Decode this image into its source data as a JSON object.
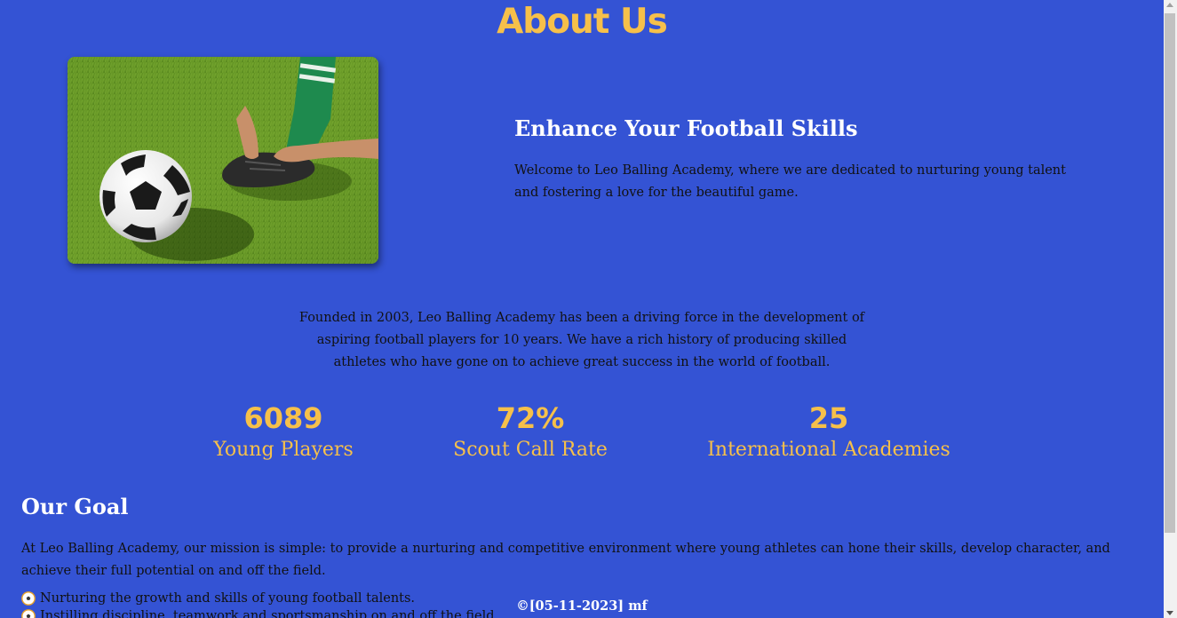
{
  "page_title": "About Us",
  "hero": {
    "image_alt": "football-player-tying-cleats",
    "heading": "Enhance Your Football Skills",
    "text": "Welcome to Leo Balling Academy, where we are dedicated to nurturing young talent and fostering a love for the beautiful game."
  },
  "founded_text": "Founded in 2003, Leo Balling Academy has been a driving force in the development of aspiring football players for 10 years. We have a rich history of producing skilled athletes who have gone on to achieve great success in the world of football.",
  "stats": [
    {
      "value": "6089",
      "label": "Young Players"
    },
    {
      "value": "72%",
      "label": "Scout Call Rate"
    },
    {
      "value": "25",
      "label": "International Academies"
    }
  ],
  "goal": {
    "heading": "Our Goal",
    "text": "At Leo Balling Academy, our mission is simple: to provide a nurturing and competitive environment where young athletes can hone their skills, develop character, and achieve their full potential on and off the field.",
    "items": [
      {
        "icon": "soccer-ball-icon",
        "text": "Nurturing the growth and skills of young football talents."
      },
      {
        "icon": "soccer-ball-icon",
        "text": "Instilling discipline, teamwork and sportsmanship on and off the field."
      }
    ]
  },
  "footer": "©[05-11-2023] mf",
  "colors": {
    "background": "#3453d4",
    "accent": "#f6c04a",
    "heading": "#ffffff",
    "body_text": "#111111"
  }
}
